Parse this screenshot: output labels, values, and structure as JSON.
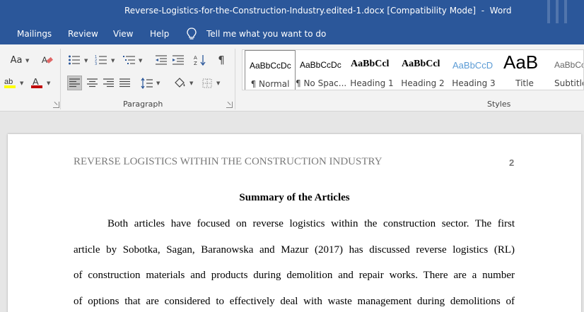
{
  "window": {
    "title": "Reverse-Logistics-for-the-Construction-Industry.edited-1.docx [Compatibility Mode]  -  Word"
  },
  "menu": {
    "items": [
      "Mailings",
      "Review",
      "View",
      "Help"
    ],
    "tell_me": "Tell me what you want to do"
  },
  "ribbon": {
    "font_size_btn": "Aa",
    "paragraph_label": "Paragraph",
    "styles_label": "Styles",
    "styles": [
      {
        "sample": "AaBbCcDc",
        "name": "¶ Normal"
      },
      {
        "sample": "AaBbCcDc",
        "name": "¶ No Spac..."
      },
      {
        "sample": "AaBbCcl",
        "name": "Heading 1"
      },
      {
        "sample": "AaBbCcl",
        "name": "Heading 2"
      },
      {
        "sample": "AaBbCcD",
        "name": "Heading 3"
      },
      {
        "sample": "AaB",
        "name": "Title"
      },
      {
        "sample": "AaBbCcD",
        "name": "Subtitle"
      }
    ]
  },
  "document": {
    "running_header": "REVERSE LOGISTICS WITHIN THE CONSTRUCTION INDUSTRY",
    "page_number": "2",
    "heading": "Summary of the Articles",
    "lines": [
      "Both articles have focused on reverse logistics within the construction sector. The first",
      "article by Sobotka,  Sagan, Baranowska and Mazur (2017) has discussed reverse logistics (RL)",
      "of construction materials and products during demolition and repair works. There are a number",
      "of options that are considered to effectively deal with waste management during demolitions of"
    ]
  },
  "colors": {
    "title_bar": "#2b579a",
    "heading3": "#5b9bd5",
    "highlight": "#ffff00",
    "font_color": "#c00000"
  }
}
